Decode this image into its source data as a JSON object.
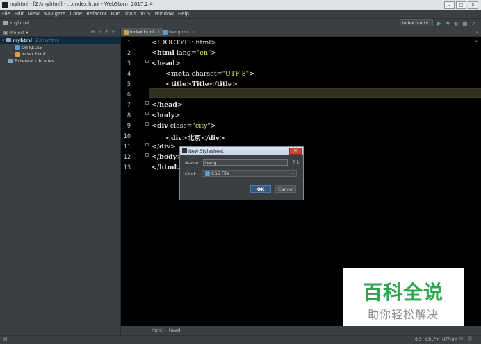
{
  "window": {
    "title": "myhtml - [Z:\\myhtml] - ...\\index.html - WebStorm 2017.2.4",
    "buttons": [
      "–",
      "□",
      "✕"
    ]
  },
  "menu": [
    "File",
    "Edit",
    "View",
    "Navigate",
    "Code",
    "Refactor",
    "Run",
    "Tools",
    "VCS",
    "Window",
    "Help"
  ],
  "navbar": {
    "project": "myhtml",
    "run_config": "index.html ▾"
  },
  "project_panel": {
    "header": "Project",
    "tree": {
      "root": "myhtml",
      "root_path": "Z:\\myhtml",
      "files": [
        "beng.css",
        "index.html"
      ],
      "external": "External Libraries"
    }
  },
  "tabs": [
    {
      "label": "index.html",
      "active": true
    },
    {
      "label": "beng.css",
      "active": false
    }
  ],
  "editor": {
    "line_numbers": [
      "1",
      "2",
      "3",
      "4",
      "5",
      "6",
      "7",
      "8",
      "9",
      "10",
      "11",
      "12",
      "13"
    ],
    "current_line": 6
  },
  "breadcrumb": [
    "html",
    "head"
  ],
  "status": {
    "position": "6:5",
    "line_sep": "CRLF+",
    "encoding": "UTF-8+"
  },
  "dialog": {
    "title": "New Stylesheet",
    "name_label": "Name:",
    "name_value": "beng",
    "kind_label": "Kind:",
    "kind_value": "CSS File",
    "ok": "OK",
    "cancel": "Cancel"
  },
  "watermark": {
    "title": "百科全说",
    "subtitle": "助你轻松解决"
  },
  "colors": {
    "editor_bg": "#000000",
    "string": "#d7e86a",
    "current_line": "#2f2f1f",
    "watermark_green": "#2aa64f"
  }
}
